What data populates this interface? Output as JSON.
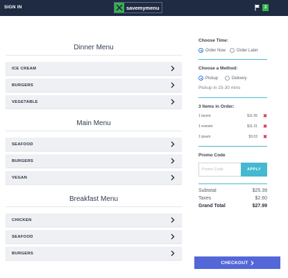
{
  "header": {
    "sign_in_label": "SIGN IN",
    "logo_text": "savemymenu",
    "cart_count": "3",
    "colors": {
      "bar": "#1f2b42",
      "accent": "#37b24d"
    },
    "icons": [
      "logo-icon",
      "cart-icon"
    ]
  },
  "menus": [
    {
      "title": "Dinner Menu",
      "items": [
        "ICE CREAM",
        "BURGERS",
        "VEGETABLE"
      ]
    },
    {
      "title": "Main Menu",
      "items": [
        "SEAFOOD",
        "BURGERS",
        "VEGAN"
      ]
    },
    {
      "title": "Breakfast Menu",
      "items": [
        "CHICKEN",
        "SEAFOOD",
        "BURGERS"
      ]
    }
  ],
  "order_panel": {
    "time": {
      "heading": "Choose Time:",
      "options": [
        "Order Now",
        "Order Later"
      ],
      "selected": "Order Now"
    },
    "method": {
      "heading": "Choose a Method:",
      "options": [
        "Pickup",
        "Delivery"
      ],
      "selected": "Pickup",
      "note": "Pickup in 15-30 mins"
    },
    "items_heading": "3 Items in Order:",
    "items": [
      {
        "name": "1 lacere",
        "price": "$11.05"
      },
      {
        "name": "1 eveniet",
        "price": "$11.31"
      },
      {
        "name": "1 ipsum",
        "price": "$3.03"
      }
    ],
    "promo": {
      "heading": "Promo Code",
      "placeholder": "Promo Code",
      "button_label": "APPLY"
    },
    "totals": {
      "subtotal_label": "Subtotal",
      "subtotal": "$25.39",
      "taxes_label": "Taxes",
      "taxes": "$2.60",
      "grand_label": "Grand Total",
      "grand": "$27.99"
    },
    "checkout_label": "CHECKOUT",
    "colors": {
      "teal": "#44b9cf",
      "remove": "#d9334a",
      "checkout": "#5467d8"
    }
  }
}
